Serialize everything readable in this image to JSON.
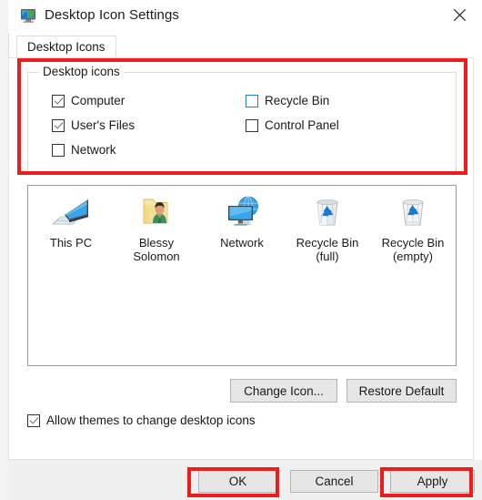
{
  "window": {
    "title": "Desktop Icon Settings",
    "icon": "display-monitor-icon",
    "close_label": "✕"
  },
  "tabs": [
    {
      "label": "Desktop Icons",
      "active": true
    }
  ],
  "group": {
    "legend": "Desktop icons",
    "checkboxes": [
      {
        "label": "Computer",
        "checked": true,
        "focused": false
      },
      {
        "label": "User's Files",
        "checked": true,
        "focused": false
      },
      {
        "label": "Network",
        "checked": false,
        "focused": false
      },
      {
        "label": "Recycle Bin",
        "checked": false,
        "focused": true
      },
      {
        "label": "Control Panel",
        "checked": false,
        "focused": false
      }
    ]
  },
  "preview": {
    "items": [
      {
        "label": "This PC",
        "icon": "this-pc-icon"
      },
      {
        "label": "Blessy\nSolomon",
        "icon": "user-folder-icon"
      },
      {
        "label": "Network",
        "icon": "network-icon"
      },
      {
        "label": "Recycle Bin\n(full)",
        "icon": "recycle-bin-full-icon"
      },
      {
        "label": "Recycle Bin\n(empty)",
        "icon": "recycle-bin-empty-icon"
      }
    ]
  },
  "actions": {
    "change_icon": "Change Icon...",
    "restore_default": "Restore Default"
  },
  "allow_themes": {
    "label": "Allow themes to change desktop icons",
    "checked": true
  },
  "footer": {
    "ok": "OK",
    "cancel": "Cancel",
    "apply": "Apply"
  },
  "annotations": {
    "color": "#ee1c1c",
    "targets": [
      "desktop-icons-group",
      "ok-button",
      "apply-button"
    ]
  }
}
